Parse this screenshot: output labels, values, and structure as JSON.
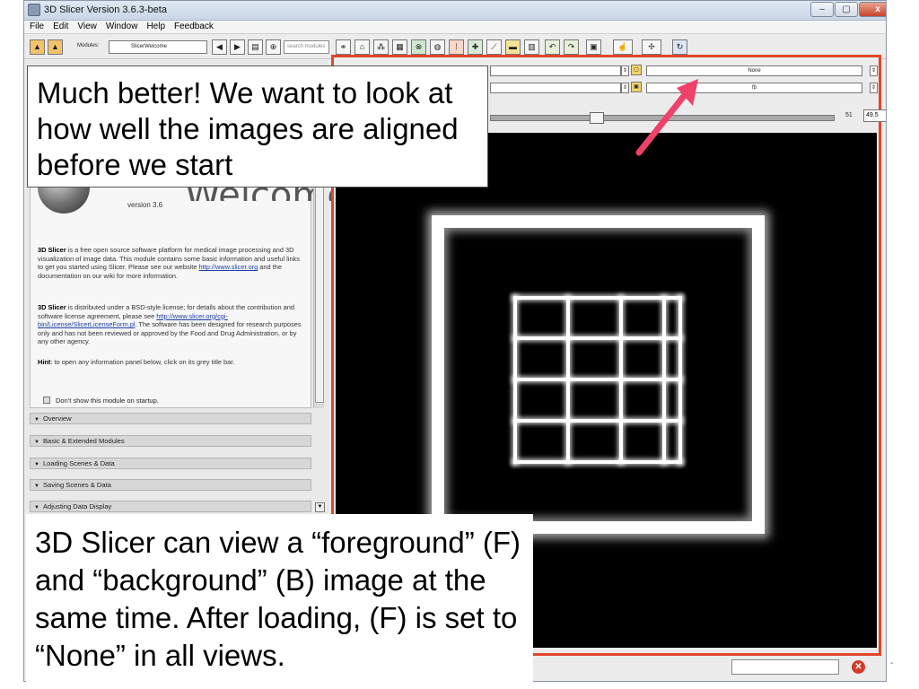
{
  "window": {
    "title": "3D Slicer Version 3.6.3-beta",
    "controls": [
      "–",
      "▢",
      "x"
    ]
  },
  "menu": [
    "File",
    "Edit",
    "View",
    "Window",
    "Help",
    "Feedback"
  ],
  "toolbar": {
    "modules_label": "Modules:",
    "module_selected": "SlicerWelcome",
    "search_placeholder": "search modules"
  },
  "welcome": {
    "version": "version 3.6",
    "heading": "Welcome",
    "para1_app": "3D Slicer",
    "para1_text": " is a free open source software platform for medical image processing and 3D visualization of image data. This module contains some basic information and useful links to get you started using Slicer. Please see our website ",
    "para1_link": "http://www.slicer.org",
    "para1_end": " and the documentation on our wiki for more information.",
    "para2_app": "3D Slicer",
    "para2_text": " is distributed under a BSD-style license; for details about the contribution and software license agreement, please see ",
    "para2_link": "http://www.slicer.org/cgi-bin/License/SlicerLicenseForm.pl",
    "para2_end": ". The software has been designed for research purposes only and has not been reviewed or approved by the Food and Drug Administration, or by any other agency.",
    "hint_label": "Hint",
    "hint_text": ": to open any information panel below, click on its grey title bar.",
    "dont_show": "Don't show this module on startup."
  },
  "sections": [
    "Overview",
    "Basic & Extended Modules",
    "Loading Scenes & Data",
    "Saving Scenes & Data",
    "Adjusting Data Display"
  ],
  "view": {
    "foreground_value": "None",
    "background_value": "fb",
    "slider_value": "51",
    "slider_field": "49.5",
    "slider_fraction": 0.3
  },
  "annotations": {
    "callout_top": "Much better! We want to look at how well the images are aligned before we start",
    "callout_bottom": "3D Slicer can view a “foreground” (F) and “background” (B) image at the same time.  After loading, (F) is set to “None” in all views.",
    "arrow_color": "#f0416a"
  },
  "colors": {
    "red_view_border": "#e2452c",
    "link": "#1b3ea8"
  }
}
